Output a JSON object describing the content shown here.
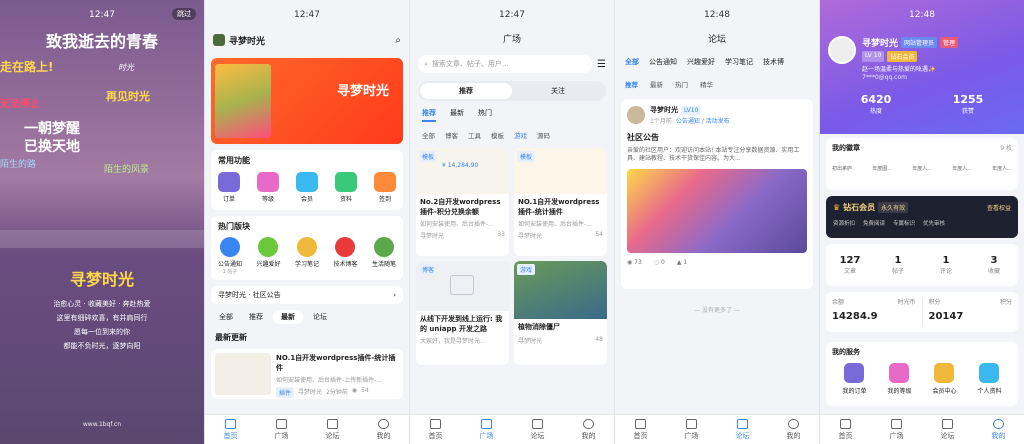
{
  "p1": {
    "time": "12:47",
    "skip": "跳过",
    "lines": [
      "致我逝去的青春",
      "走在路上!",
      "时光",
      "再见时光",
      "无法停止",
      "一朝梦醒",
      "已换天地",
      "陌生的路",
      "陌生的风景",
      "",
      "寻梦时光",
      "治愈心灵 · 收藏美好 · 奔赴热爱",
      "这里有细碎欢喜，有并肩同行",
      "愿每一位到来的你",
      "都能不负时光，逐梦向阳"
    ],
    "url": "www.1bqf.cn"
  },
  "p2": {
    "time": "12:47",
    "app": "寻梦时光",
    "poster_title": "寻梦时光",
    "section1": "常用功能",
    "funcs": [
      "订单",
      "等级",
      "会员",
      "资料",
      "签到"
    ],
    "section2": "热门版块",
    "boards": [
      "公告通知",
      "兴趣爱好",
      "学习笔记",
      "技术博客",
      "生活随笔"
    ],
    "board_sub": "1 帖子",
    "notice": "寻梦时光 · 社区公告",
    "tabs": [
      "全部",
      "推荐",
      "最新",
      "论坛"
    ],
    "section3": "最新更新",
    "post_title": "NO.1自开发wordpress插件-统计插件",
    "post_desc": "如何安装使用、后台插件-上传新插件-...",
    "post_tag": "插件",
    "post_author": "寻梦时光",
    "post_time": "2分钟前",
    "post_views": "54",
    "nav": [
      "首页",
      "广场",
      "论坛",
      "我的"
    ]
  },
  "p3": {
    "time": "12:47",
    "title": "广场",
    "search": "搜索文章、帖子、用户...",
    "seg": [
      "推荐",
      "关注"
    ],
    "tabs": [
      "推荐",
      "最新",
      "热门"
    ],
    "cats": [
      "全部",
      "博客",
      "工具",
      "模板",
      "游戏",
      "源码"
    ],
    "cards": [
      {
        "badge": "模板",
        "price": "¥ 14,284.90",
        "title": "No.2自开发wordpress插件-积分兑换余额",
        "desc": "如何安装使用、后台插件-...",
        "author": "寻梦时光",
        "views": "33"
      },
      {
        "badge": "模板",
        "title": "NO.1自开发wordpress插件-统计插件",
        "desc": "如何安装使用、后台插件-...",
        "author": "寻梦时光",
        "views": "54"
      },
      {
        "badge": "博客",
        "title": "从线下开发到线上运行: 我的 uniapp 开发之路",
        "desc": "大家好，我是寻梦时光...",
        "author": "寻梦时光",
        "views": "33"
      },
      {
        "badge": "游戏",
        "title": "植物消除僵尸",
        "author": "寻梦时光",
        "views": "48"
      }
    ],
    "nav": [
      "首页",
      "广场",
      "论坛",
      "我的"
    ]
  },
  "p4": {
    "time": "12:48",
    "title": "论坛",
    "tabs": [
      "全部",
      "公告通知",
      "兴趣爱好",
      "学习笔记",
      "技术博"
    ],
    "sub": [
      "推荐",
      "最新",
      "热门",
      "精华"
    ],
    "author": "寻梦时光",
    "level": "LV10",
    "ago": "1个月前",
    "cat": "公告通知 / 活动发布",
    "post_title": "社区公告",
    "post_desc": "亲爱的社区用户：欢迎访问本站! 本站专注分享数据资源、实用工具、建站教程、技术干货保佳内容。为大...",
    "views": "73",
    "comments": "0",
    "likes": "1",
    "end": "— 没有更多了 —",
    "nav": [
      "首页",
      "广场",
      "论坛",
      "我的"
    ]
  },
  "p5": {
    "time": "12:48",
    "name": "寻梦时光",
    "b1": "网站管理员",
    "b2": "管理",
    "lv": "LV 10",
    "vip": "钻石会员",
    "bio": "赵一场温柔与热爱的吆遇✨",
    "mail": "7***0@qq.com",
    "heat": "6420",
    "heat_l": "热度",
    "fans": "1255",
    "fans_l": "获赞",
    "badges_t": "我的徽章",
    "badges_n": "9 枚",
    "badges": [
      "初出茅庐",
      "年度图...",
      "年度人...",
      "年度人...",
      "年度人..."
    ],
    "vip_t": "钻石会员",
    "vip_s": "永久有效",
    "vip_btn": "查看权益",
    "vip_feats": [
      "资源折扣",
      "免费阅读",
      "专属标识",
      "优先审核"
    ],
    "stats": [
      {
        "v": "127",
        "l": "文章"
      },
      {
        "v": "1",
        "l": "帖子"
      },
      {
        "v": "1",
        "l": "评论"
      },
      {
        "v": "3",
        "l": "收藏"
      }
    ],
    "bal_l": "余额",
    "bal_sub": "时光币",
    "bal": "14284.9",
    "pts_l": "积分",
    "pts_sub": "积分",
    "pts": "20147",
    "svc_t": "我的服务",
    "svcs": [
      "我的订单",
      "我的等级",
      "会员中心",
      "个人资料"
    ],
    "nav": [
      "首页",
      "广场",
      "论坛",
      "我的"
    ]
  }
}
